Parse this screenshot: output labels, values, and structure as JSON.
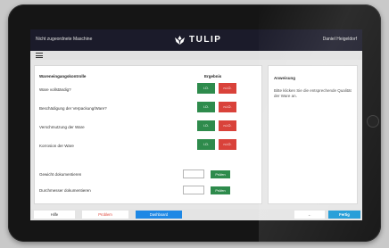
{
  "topbar": {
    "machine_label": "Nicht zugeordnete Maschine",
    "logo_text": "TULIP",
    "user_name": "Daniel Heigeldorf"
  },
  "inspection": {
    "title": "Wareneingangskontrolle",
    "result_header": "Ergebnis",
    "ok_label": "i.O.",
    "nok_label": "n.i.O.",
    "rows": [
      {
        "label": "Ware vollständig?"
      },
      {
        "label": "Beschädigung der Verpackung/Ware?"
      },
      {
        "label": "Verschmutzung der Ware"
      },
      {
        "label": "Korrosion der Ware"
      }
    ],
    "measurements": [
      {
        "label": "Gewicht dokumentieren",
        "value": "",
        "button": "Prüfen"
      },
      {
        "label": "Durchmesser dokumentieren",
        "value": "",
        "button": "Prüfen"
      }
    ]
  },
  "instruction": {
    "title": "Anweisung",
    "text": "Bitte klicken Sie die entsprechende Qualität der Ware an."
  },
  "bottombar": {
    "help": "Hilfe",
    "problem": "Problem",
    "dashboard": "Dashboard",
    "back": "←",
    "done": "Fertig"
  },
  "colors": {
    "ok": "#2e8b4c",
    "nok": "#d9423a",
    "accent": "#1e88e5",
    "topbar": "#1b1b2a"
  }
}
